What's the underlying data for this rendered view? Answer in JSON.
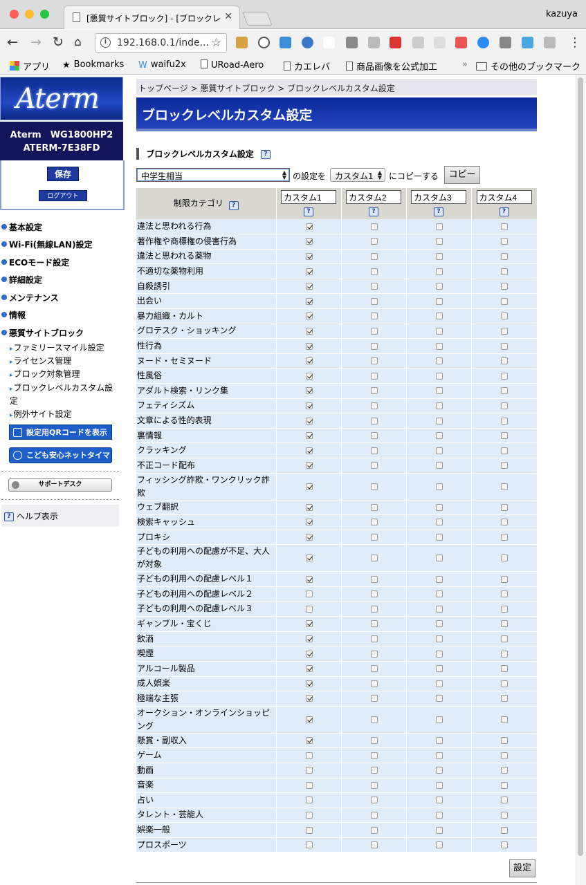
{
  "browser": {
    "tab_title": "[悪質サイトブロック] - [ブロックレ",
    "profile": "kazuya",
    "url": "192.168.0.1/inde..."
  },
  "bookmarks": [
    {
      "label": "アプリ"
    },
    {
      "label": "Bookmarks"
    },
    {
      "label": "waifu2x"
    },
    {
      "label": "URoad-Aero"
    },
    {
      "label": "カエレバ"
    },
    {
      "label": "商品画像を公式加工"
    },
    {
      "label": "その他のブックマーク"
    }
  ],
  "sidebar": {
    "logo": "Aterm",
    "model_line1": "Aterm　WG1800HP2",
    "model_line2": "ATERM-7E38FD",
    "save": "保存",
    "logout": "ログアウト",
    "menu": [
      "基本設定",
      "Wi-Fi(無線LAN)設定",
      "ECOモード設定",
      "詳細設定",
      "メンテナンス",
      "情報",
      "悪質サイトブロック"
    ],
    "submenu": [
      "ファミリースマイル設定",
      "ライセンス管理",
      "ブロック対象管理",
      "ブロックレベルカスタム設",
      "定",
      "例外サイト設定"
    ],
    "qr_button": "設定用QRコードを表示",
    "timer_button": "こども安心ネットタイマー",
    "support": "サポートデスク",
    "help": "ヘルプ表示"
  },
  "main": {
    "breadcrumb": "トップページ > 悪質サイトブロック > ブロックレベルカスタム設定",
    "title": "ブロックレベルカスタム設定",
    "section_title": "ブロックレベルカスタム設定",
    "help_mark": "?",
    "preset_value": "中学生相当",
    "text_settings_of": "の設定を",
    "copy_target": "カスタム1",
    "text_copy_to": "にコピーする",
    "copy_button": "コピー",
    "category_header": "制限カテゴリ",
    "custom_headers": [
      "カスタム1",
      "カスタム2",
      "カスタム3",
      "カスタム4"
    ],
    "apply_button": "設定"
  },
  "categories": [
    {
      "name": "違法と思われる行為",
      "checks": [
        true,
        false,
        false,
        false
      ]
    },
    {
      "name": "著作権や商標権の侵害行為",
      "checks": [
        true,
        false,
        false,
        false
      ]
    },
    {
      "name": "違法と思われる薬物",
      "checks": [
        true,
        false,
        false,
        false
      ]
    },
    {
      "name": "不適切な薬物利用",
      "checks": [
        true,
        false,
        false,
        false
      ]
    },
    {
      "name": "自殺誘引",
      "checks": [
        true,
        false,
        false,
        false
      ]
    },
    {
      "name": "出会い",
      "checks": [
        true,
        false,
        false,
        false
      ]
    },
    {
      "name": "暴力組織・カルト",
      "checks": [
        true,
        false,
        false,
        false
      ]
    },
    {
      "name": "グロテスク・ショッキング",
      "checks": [
        true,
        false,
        false,
        false
      ]
    },
    {
      "name": "性行為",
      "checks": [
        true,
        false,
        false,
        false
      ]
    },
    {
      "name": "ヌード・セミヌード",
      "checks": [
        true,
        false,
        false,
        false
      ]
    },
    {
      "name": "性風俗",
      "checks": [
        true,
        false,
        false,
        false
      ]
    },
    {
      "name": "アダルト検索・リンク集",
      "checks": [
        true,
        false,
        false,
        false
      ]
    },
    {
      "name": "フェティシズム",
      "checks": [
        true,
        false,
        false,
        false
      ]
    },
    {
      "name": "文章による性的表現",
      "checks": [
        true,
        false,
        false,
        false
      ]
    },
    {
      "name": "裏情報",
      "checks": [
        true,
        false,
        false,
        false
      ]
    },
    {
      "name": "クラッキング",
      "checks": [
        true,
        false,
        false,
        false
      ]
    },
    {
      "name": "不正コード配布",
      "checks": [
        true,
        false,
        false,
        false
      ]
    },
    {
      "name": "フィッシング詐欺・ワンクリック詐欺",
      "checks": [
        true,
        false,
        false,
        false
      ]
    },
    {
      "name": "ウェブ翻訳",
      "checks": [
        true,
        false,
        false,
        false
      ]
    },
    {
      "name": "検索キャッシュ",
      "checks": [
        true,
        false,
        false,
        false
      ]
    },
    {
      "name": "プロキシ",
      "checks": [
        true,
        false,
        false,
        false
      ]
    },
    {
      "name": "子どもの利用への配慮が不足、大人が対象",
      "checks": [
        true,
        false,
        false,
        false
      ]
    },
    {
      "name": "子どもの利用への配慮レベル１",
      "checks": [
        true,
        false,
        false,
        false
      ]
    },
    {
      "name": "子どもの利用への配慮レベル２",
      "checks": [
        false,
        false,
        false,
        false
      ]
    },
    {
      "name": "子どもの利用への配慮レベル３",
      "checks": [
        false,
        false,
        false,
        false
      ]
    },
    {
      "name": "ギャンブル・宝くじ",
      "checks": [
        true,
        false,
        false,
        false
      ]
    },
    {
      "name": "飲酒",
      "checks": [
        true,
        false,
        false,
        false
      ]
    },
    {
      "name": "喫煙",
      "checks": [
        true,
        false,
        false,
        false
      ]
    },
    {
      "name": "アルコール製品",
      "checks": [
        true,
        false,
        false,
        false
      ]
    },
    {
      "name": "成人娯楽",
      "checks": [
        true,
        false,
        false,
        false
      ]
    },
    {
      "name": "極端な主張",
      "checks": [
        true,
        false,
        false,
        false
      ]
    },
    {
      "name": "オークション・オンラインショッピング",
      "checks": [
        true,
        false,
        false,
        false
      ]
    },
    {
      "name": "懸賞・副収入",
      "checks": [
        true,
        false,
        false,
        false
      ]
    },
    {
      "name": "ゲーム",
      "checks": [
        false,
        false,
        false,
        false
      ]
    },
    {
      "name": "動画",
      "checks": [
        false,
        false,
        false,
        false
      ]
    },
    {
      "name": "音楽",
      "checks": [
        false,
        false,
        false,
        false
      ]
    },
    {
      "name": "占い",
      "checks": [
        false,
        false,
        false,
        false
      ]
    },
    {
      "name": "タレント・芸能人",
      "checks": [
        false,
        false,
        false,
        false
      ]
    },
    {
      "name": "娯楽一般",
      "checks": [
        false,
        false,
        false,
        false
      ]
    },
    {
      "name": "プロスポーツ",
      "checks": [
        false,
        false,
        false,
        false
      ]
    }
  ]
}
